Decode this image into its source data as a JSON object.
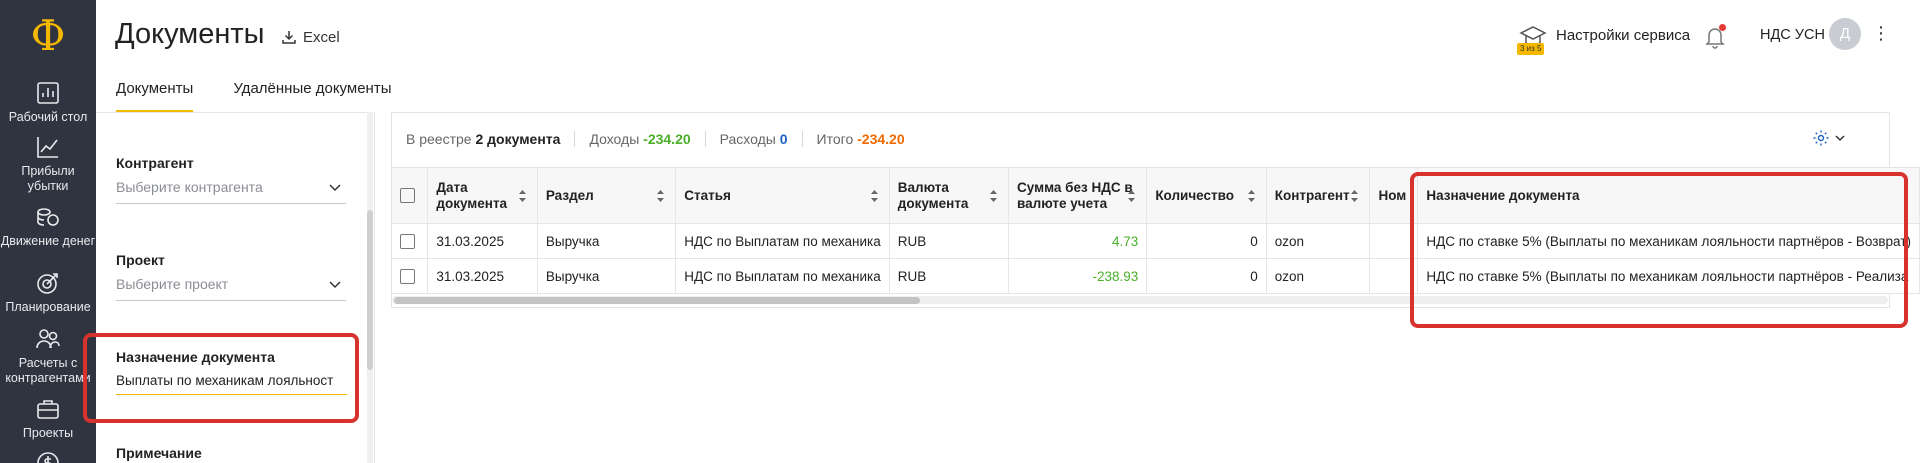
{
  "nav": {
    "logo": "Ф",
    "items": [
      {
        "label": "Рабочий стол",
        "icon": "dashboard-icon"
      },
      {
        "label": "Прибыли убытки",
        "icon": "profit-chart-icon"
      },
      {
        "label": "Движение денег",
        "icon": "money-flow-icon"
      },
      {
        "label": "Планирование",
        "icon": "planning-icon"
      },
      {
        "label": "Расчеты с контрагентами",
        "icon": "counterparties-icon"
      },
      {
        "label": "Проекты",
        "icon": "briefcase-icon"
      }
    ]
  },
  "header": {
    "title": "Документы",
    "excel_label": "Excel",
    "service_badge": "3 из 5",
    "service_label": "Настройки сервиса",
    "org_label": "НДС УСН",
    "avatar_letter": "Д",
    "kebab": "⋮"
  },
  "tabs": [
    {
      "label": "Документы",
      "active": true
    },
    {
      "label": "Удалённые документы",
      "active": false
    }
  ],
  "filters": {
    "counterparty": {
      "label": "Контрагент",
      "placeholder": "Выберите контрагента"
    },
    "project": {
      "label": "Проект",
      "placeholder": "Выберите проект"
    },
    "purpose": {
      "label": "Назначение документа",
      "value": "Выплаты по механикам лояльност"
    },
    "note": {
      "label": "Примечание"
    }
  },
  "summary": {
    "registry_prefix": "В реестре",
    "registry_count": "2 документа",
    "income_label": "Доходы",
    "income_value": "-234.20",
    "expense_label": "Расходы",
    "expense_value": "0",
    "total_label": "Итого",
    "total_value": "-234.20"
  },
  "table": {
    "columns": [
      "Дата документа",
      "Раздел",
      "Статья",
      "Валюта документа",
      "Сумма без НДС в валюте учета",
      "Количество",
      "Контрагент",
      "Ном",
      "Назначение документа"
    ],
    "rows": [
      {
        "date": "31.03.2025",
        "section": "Выручка",
        "article": "НДС по Выплатам по механика",
        "currency": "RUB",
        "amount": "4.73",
        "qty": "0",
        "counterparty": "ozon",
        "num": "",
        "purpose": "НДС по ставке 5% (Выплаты по механикам лояльности партнёров - Возврат)"
      },
      {
        "date": "31.03.2025",
        "section": "Выручка",
        "article": "НДС по Выплатам по механика",
        "currency": "RUB",
        "amount": "-238.93",
        "qty": "0",
        "counterparty": "ozon",
        "num": "",
        "purpose": "НДС по ставке 5% (Выплаты по механикам лояльности партнёров - Реализа"
      }
    ]
  },
  "colors": {
    "nav_bg": "#2f3440",
    "accent": "#f5b800",
    "positive": "#4caf2a",
    "negative": "#f06a00",
    "link_blue": "#1e63c3",
    "highlight_red": "#d8322c"
  }
}
